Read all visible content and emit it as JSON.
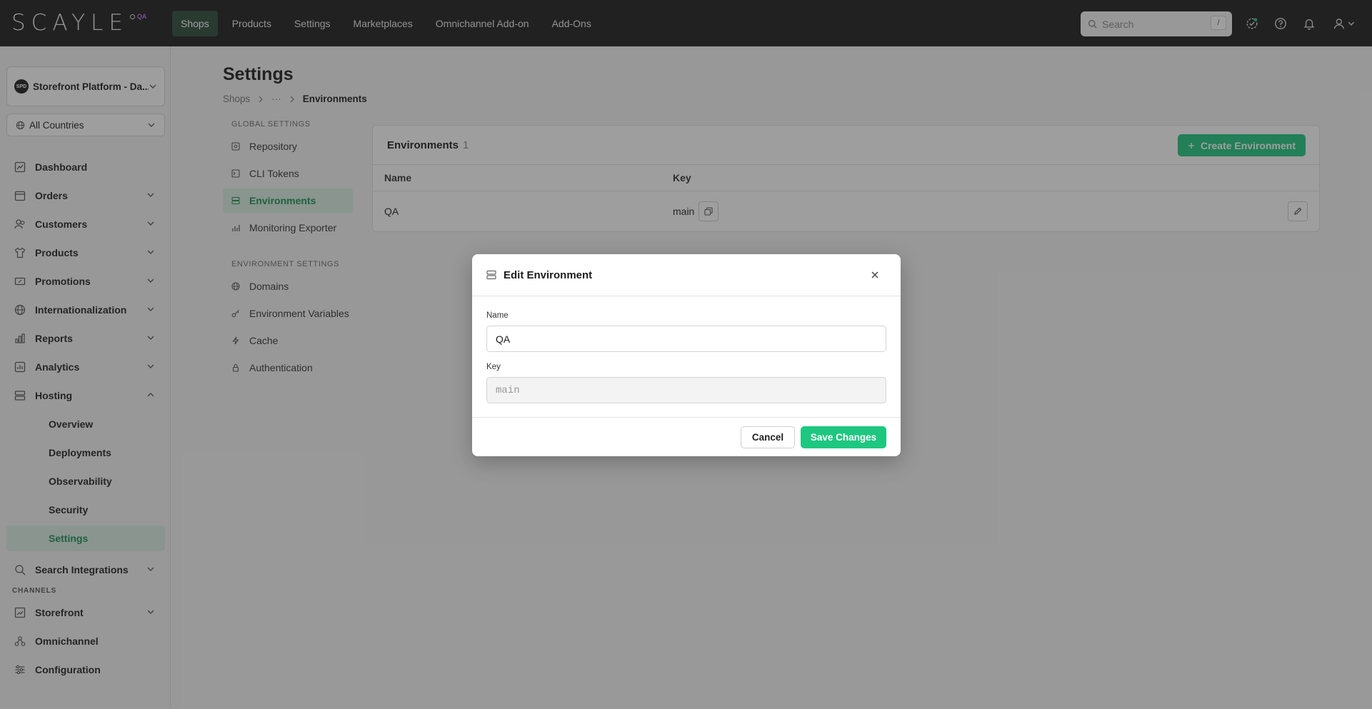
{
  "brand": {
    "logo_text": "SCAYLE",
    "env_badge": "QA",
    "accent": "#1ec780"
  },
  "topnav": {
    "items": [
      {
        "label": "Shops",
        "active": true
      },
      {
        "label": "Products"
      },
      {
        "label": "Settings"
      },
      {
        "label": "Marketplaces"
      },
      {
        "label": "Omnichannel Add-on"
      },
      {
        "label": "Add-Ons"
      }
    ],
    "search_placeholder": "Search",
    "search_shortcut": "/"
  },
  "sidebar": {
    "shop_avatar": "SPD",
    "shop_name": "Storefront Platform - Da...",
    "country": "All Countries",
    "items": [
      {
        "label": "Dashboard"
      },
      {
        "label": "Orders"
      },
      {
        "label": "Customers"
      },
      {
        "label": "Products"
      },
      {
        "label": "Promotions"
      },
      {
        "label": "Internationalization"
      },
      {
        "label": "Reports"
      },
      {
        "label": "Analytics"
      },
      {
        "label": "Hosting"
      }
    ],
    "hosting_sub": [
      {
        "label": "Overview"
      },
      {
        "label": "Deployments"
      },
      {
        "label": "Observability"
      },
      {
        "label": "Security"
      },
      {
        "label": "Settings",
        "active": true
      }
    ],
    "search_integrations": "Search Integrations",
    "channels_label": "CHANNELS",
    "channels": [
      {
        "label": "Storefront"
      },
      {
        "label": "Omnichannel"
      },
      {
        "label": "Configuration"
      }
    ]
  },
  "page": {
    "title": "Settings",
    "breadcrumb": {
      "root": "Shops",
      "ellipsis": "···",
      "current": "Environments"
    },
    "global_settings_label": "GLOBAL SETTINGS",
    "global_settings": [
      {
        "label": "Repository"
      },
      {
        "label": "CLI Tokens"
      },
      {
        "label": "Environments",
        "active": true
      },
      {
        "label": "Monitoring Exporter"
      }
    ],
    "environment_settings_label": "ENVIRONMENT SETTINGS",
    "environment_settings": [
      {
        "label": "Domains"
      },
      {
        "label": "Environment Variables"
      },
      {
        "label": "Cache"
      },
      {
        "label": "Authentication"
      }
    ]
  },
  "environments": {
    "title": "Environments",
    "count": "1",
    "create_label": "Create Environment",
    "columns": {
      "name": "Name",
      "key": "Key"
    },
    "rows": [
      {
        "name": "QA",
        "key": "main"
      }
    ]
  },
  "modal": {
    "title": "Edit Environment",
    "name_label": "Name",
    "name_value": "QA",
    "key_label": "Key",
    "key_value": "main",
    "cancel_label": "Cancel",
    "save_label": "Save Changes"
  }
}
